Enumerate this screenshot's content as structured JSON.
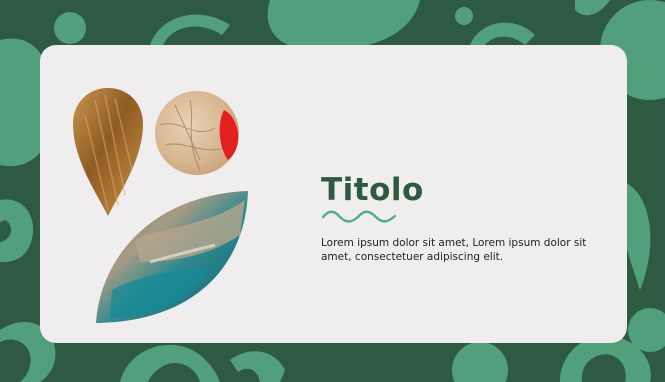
{
  "slide": {
    "title": "Titolo",
    "body": "Lorem ipsum dolor sit amet, Lorem ipsum dolor sit amet, consectetuer adipiscing elit."
  },
  "colors": {
    "background": "#2e5a40",
    "decoration": "#52a07b",
    "card": "#efeded",
    "title": "#2d5a40",
    "squiggle": "#4fae87"
  },
  "images": [
    {
      "name": "wheat-photo",
      "shape": "drop"
    },
    {
      "name": "map-photo",
      "shape": "circle"
    },
    {
      "name": "coast-photo",
      "shape": "leaf"
    }
  ]
}
